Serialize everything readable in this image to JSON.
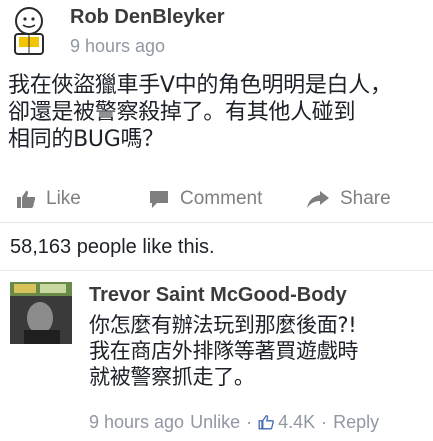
{
  "post": {
    "author": "Rob DenBleyker",
    "time": "9 hours ago",
    "body": "我在俠盜獵車手V中的角色明明是白人，\n卻還是被警察殺掉了。有其他人碰到\n相同的BUG嗎？"
  },
  "actions": {
    "like_label": "Like",
    "comment_label": "Comment",
    "share_label": "Share"
  },
  "likes": {
    "summary": "58,163 people like this."
  },
  "comment": {
    "author": "Trevor Saint McGood-Body",
    "text": "你怎麼有辦法玩到那麼後面?!\n我在商店外排隊等著買遊戲時\n就被警察抓走了。",
    "time": "9 hours ago",
    "unlike_label": "Unlike",
    "separator": "·",
    "like_count": "4.4K",
    "reply_label": "Reply"
  },
  "colors": {
    "text": "#1d2129",
    "muted": "#9197a3",
    "action": "#7f7f7f",
    "like_icon": "#4267b2"
  },
  "icons": {
    "avatar": "cyanide-happiness-avatar",
    "like": "thumbs-up-icon",
    "comment": "speech-bubble-icon",
    "share": "share-arrow-icon",
    "comment_like": "thumbs-up-outline-icon"
  }
}
